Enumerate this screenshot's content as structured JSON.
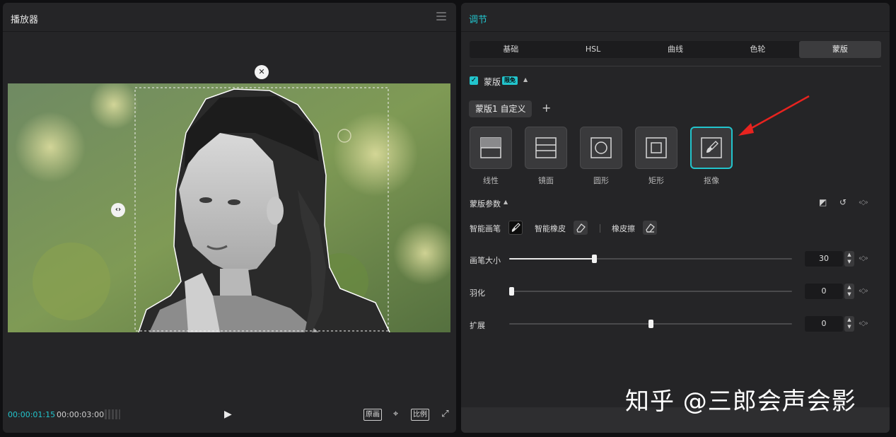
{
  "player": {
    "title": "播放器",
    "current_time": "00:00:01:15",
    "total_time": "00:00:03:00",
    "btn_original": "原画",
    "btn_ratio": "比例"
  },
  "adjust": {
    "title": "调节",
    "tabs": [
      {
        "label": "基础"
      },
      {
        "label": "HSL"
      },
      {
        "label": "曲线"
      },
      {
        "label": "色轮"
      },
      {
        "label": "蒙版",
        "active": true
      }
    ],
    "mask_section": {
      "enabled": true,
      "title": "蒙版",
      "badge": "限免",
      "mask_name": "蒙版1 自定义",
      "types": [
        {
          "label": "线性",
          "icon": "linear-mask-icon"
        },
        {
          "label": "镜面",
          "icon": "mirror-mask-icon"
        },
        {
          "label": "圆形",
          "icon": "circle-mask-icon"
        },
        {
          "label": "矩形",
          "icon": "rectangle-mask-icon"
        },
        {
          "label": "抠像",
          "icon": "brush-cutout-icon",
          "selected": true
        }
      ]
    },
    "params": {
      "title": "蒙版参数",
      "tools": [
        {
          "label": "智能画笔",
          "icon": "smart-brush-icon",
          "active": true
        },
        {
          "label": "智能橡皮",
          "icon": "smart-eraser-icon"
        },
        {
          "label": "橡皮擦",
          "icon": "eraser-icon"
        }
      ],
      "sliders": [
        {
          "label": "画笔大小",
          "value": "30",
          "fraction": 0.3
        },
        {
          "label": "羽化",
          "value": "0",
          "fraction": 0.0
        },
        {
          "label": "扩展",
          "value": "0",
          "fraction": 0.5
        }
      ]
    }
  },
  "watermark": "知乎 @三郎会声会影",
  "colors": {
    "accent": "#22c4cc",
    "panel": "#252527",
    "background": "#101012",
    "annotation_arrow": "#e8231f"
  }
}
